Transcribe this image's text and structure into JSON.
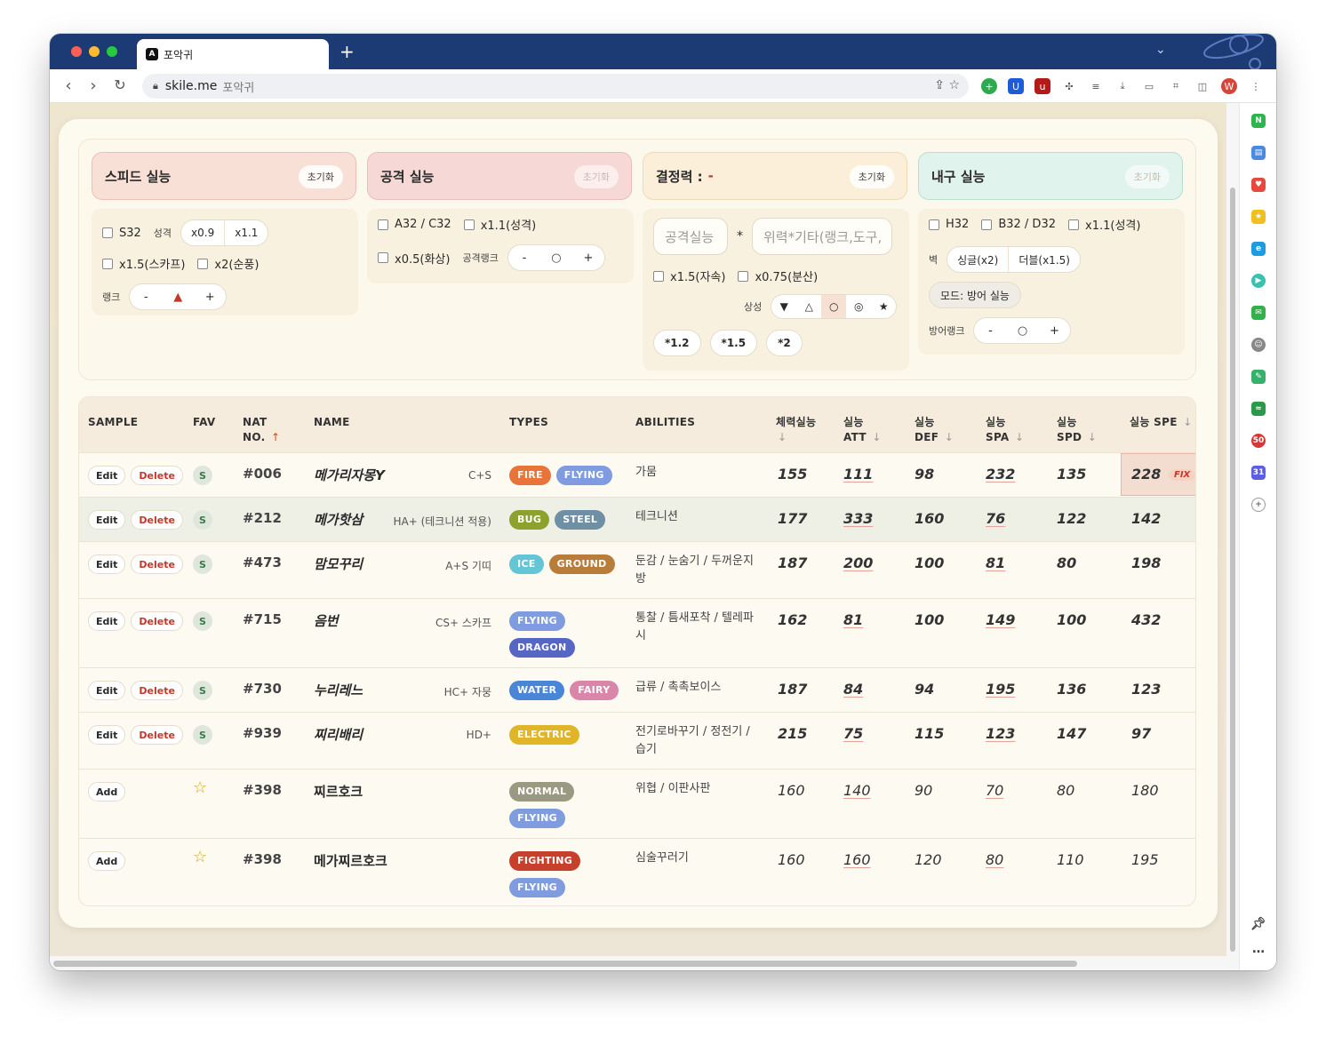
{
  "browser": {
    "tab_title": "포악귀",
    "tab_icon_letter": "A",
    "new_tab": "+",
    "url_domain": "skile.me",
    "url_title": "포악귀"
  },
  "panels": {
    "speed": {
      "title": "스피드 실능",
      "reset": "초기화",
      "s32": "S32",
      "nature": "성격",
      "n09": "x0.9",
      "n11": "x1.1",
      "scarf": "x1.5(스카프)",
      "tailwind": "x2(순풍)",
      "rank": "랭크",
      "minus": "-",
      "plus": "+",
      "rank_mark": "▲"
    },
    "attack": {
      "title": "공격 실능",
      "reset": "초기화",
      "a32": "A32 / C32",
      "nature": "x1.1(성격)",
      "burn": "x0.5(화상)",
      "rank": "공격랭크",
      "minus": "-",
      "plus": "+",
      "rank_mark": "○"
    },
    "decisive": {
      "title": "결정력 :",
      "value": "-",
      "reset": "초기화",
      "atk_placeholder": "공격실능",
      "multiply": "*",
      "power_placeholder": "위력*기타(랭크,도구,",
      "stab": "x1.5(자속)",
      "spread": "x0.75(분산)",
      "synergy": "상성",
      "syn": [
        "▼",
        "△",
        "○",
        "◎",
        "★"
      ],
      "mults": [
        "*1.2",
        "*1.5",
        "*2"
      ]
    },
    "bulk": {
      "title": "내구 실능",
      "reset": "초기화",
      "h32": "H32",
      "b32": "B32 / D32",
      "nature": "x1.1(성격)",
      "wall": "벽",
      "single": "싱글(x2)",
      "double": "더블(x1.5)",
      "mode": "모드: 방어 실능",
      "rank": "방어랭크",
      "minus": "-",
      "plus": "+",
      "rank_mark": "○"
    }
  },
  "table": {
    "headers": {
      "sample": "SAMPLE",
      "fav": "FAV",
      "nat1": "NAT",
      "nat2": "NO.",
      "name": "NAME",
      "types": "TYPES",
      "abilities": "ABILITIES",
      "hp1": "체력실능",
      "att1": "실능",
      "att2": "ATT",
      "def1": "실능",
      "def2": "DEF",
      "spa1": "실능",
      "spa2": "SPA",
      "spd1": "실능",
      "spd2": "SPD",
      "spe": "실능 SPE",
      "arrow_up": "↑",
      "arrow_down": "↓"
    },
    "labels": {
      "edit": "Edit",
      "delete": "Delete",
      "add": "Add",
      "fav_s": "S",
      "star": "☆",
      "fix": "FIX"
    },
    "rows": [
      {
        "kind": "edit",
        "no": "#006",
        "name": "메가리자몽Y",
        "sub": "C+S",
        "types": [
          {
            "t": "FIRE",
            "c": "#e8743a"
          },
          {
            "t": "FLYING",
            "c": "#7f9ce0"
          }
        ],
        "abilities": "가뭄",
        "hp": "155",
        "att": "111",
        "def": "98",
        "spa": "232",
        "spd": "135",
        "spe": "228"
      },
      {
        "kind": "edit",
        "no": "#212",
        "name": "메가핫삼",
        "sub": "HA+ (테크니션 적용)",
        "types": [
          {
            "t": "BUG",
            "c": "#8ca22c"
          },
          {
            "t": "STEEL",
            "c": "#6f8fa4"
          }
        ],
        "abilities": "테크니션",
        "hp": "177",
        "att": "333",
        "def": "160",
        "spa": "76",
        "spd": "122",
        "spe": "142"
      },
      {
        "kind": "edit",
        "no": "#473",
        "name": "맘모꾸리",
        "sub": "A+S 기띠",
        "types": [
          {
            "t": "ICE",
            "c": "#63c5d6"
          },
          {
            "t": "GROUND",
            "c": "#b87d3a"
          }
        ],
        "abilities": "둔감 / 눈숨기 / 두꺼운지방",
        "hp": "187",
        "att": "200",
        "def": "100",
        "spa": "81",
        "spd": "80",
        "spe": "198"
      },
      {
        "kind": "edit",
        "no": "#715",
        "name": "음번",
        "sub": "CS+ 스카프",
        "types": [
          {
            "t": "FLYING",
            "c": "#7f9ce0"
          },
          {
            "t": "DRAGON",
            "c": "#5566c4"
          }
        ],
        "abilities": "통찰 / 틈새포착 / 텔레파시",
        "hp": "162",
        "att": "81",
        "def": "100",
        "spa": "149",
        "spd": "100",
        "spe": "432"
      },
      {
        "kind": "edit",
        "no": "#730",
        "name": "누리레느",
        "sub": "HC+ 자뭉",
        "types": [
          {
            "t": "WATER",
            "c": "#4a86d8"
          },
          {
            "t": "FAIRY",
            "c": "#d986aa"
          }
        ],
        "abilities": "급류 / 촉촉보이스",
        "hp": "187",
        "att": "84",
        "def": "94",
        "spa": "195",
        "spd": "136",
        "spe": "123"
      },
      {
        "kind": "edit",
        "no": "#939",
        "name": "찌리배리",
        "sub": "HD+",
        "types": [
          {
            "t": "ELECTRIC",
            "c": "#e0b528"
          }
        ],
        "abilities": "전기로바꾸기 / 정전기 / 습기",
        "hp": "215",
        "att": "75",
        "def": "115",
        "spa": "123",
        "spd": "147",
        "spe": "97"
      },
      {
        "kind": "add",
        "no": "#398",
        "name": "찌르호크",
        "sub": "",
        "types": [
          {
            "t": "NORMAL",
            "c": "#9a9a82"
          },
          {
            "t": "FLYING",
            "c": "#7f9ce0"
          }
        ],
        "abilities": "위협 / 이판사판",
        "hp": "160",
        "att": "140",
        "def": "90",
        "spa": "70",
        "spd": "80",
        "spe": "180"
      },
      {
        "kind": "add",
        "no": "#398",
        "name": "메가찌르호크",
        "sub": "",
        "types": [
          {
            "t": "FIGHTING",
            "c": "#c7402c"
          },
          {
            "t": "FLYING",
            "c": "#7f9ce0"
          }
        ],
        "abilities": "심술꾸러기",
        "hp": "160",
        "att": "160",
        "def": "120",
        "spa": "80",
        "spd": "110",
        "spe": "195"
      }
    ]
  },
  "colors": {
    "titlebar": "#1c3a74",
    "accent_red": "#c0392b",
    "speed_header": "#f8e0d6",
    "attack_header": "#f6d9d6",
    "decisive_header": "#fbefd9",
    "bulk_header": "#e0f3ec"
  }
}
